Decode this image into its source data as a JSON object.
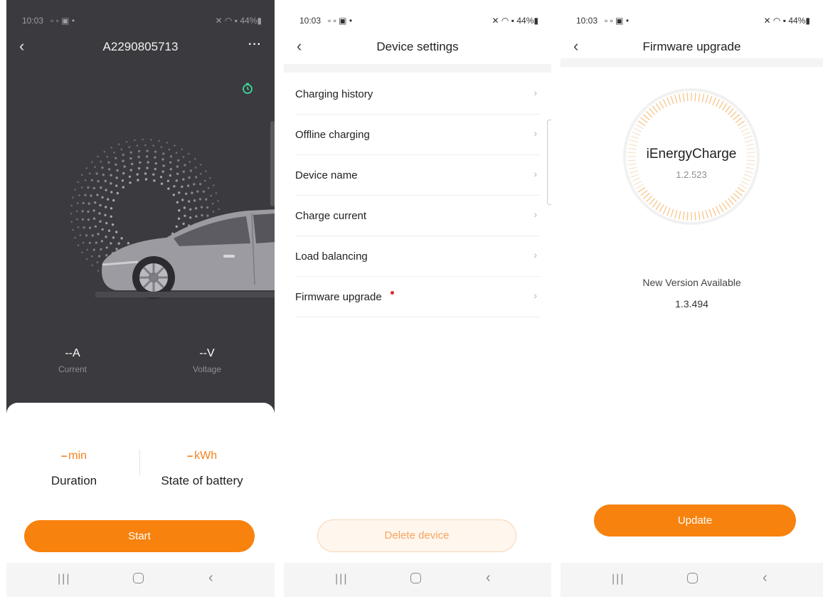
{
  "status_bar": {
    "time": "10:03",
    "left_extra": "▫ ▫ ▣ •",
    "battery": "44%"
  },
  "charger": {
    "title": "A2290805713",
    "more": "···",
    "current_value": "--A",
    "current_label": "Current",
    "voltage_value": "--V",
    "voltage_label": "Voltage",
    "duration_value": "--",
    "duration_unit": "min",
    "duration_label": "Duration",
    "battery_value": "--",
    "battery_unit": "kWh",
    "battery_label": "State of battery",
    "start_label": "Start"
  },
  "settings": {
    "title": "Device settings",
    "items": [
      {
        "label": "Charging history",
        "badge": false
      },
      {
        "label": "Offline charging",
        "badge": false
      },
      {
        "label": "Device name",
        "badge": false
      },
      {
        "label": "Charge current",
        "badge": false
      },
      {
        "label": "Load balancing",
        "badge": false
      },
      {
        "label": "Firmware upgrade",
        "badge": true
      }
    ],
    "delete_label": "Delete device"
  },
  "firmware": {
    "title": "Firmware upgrade",
    "app_name": "iEnergyCharge",
    "current_version": "1.2.523",
    "new_label": "New Version Available",
    "new_version": "1.3.494",
    "update_label": "Update"
  },
  "colors": {
    "accent": "#f7820e",
    "dark_bg": "#3b3a3e",
    "badge": "#e3282d"
  },
  "icons": {
    "back": "chevron-left-icon",
    "more": "more-icon",
    "timer": "timer-icon",
    "row": "chevron-right-icon"
  }
}
